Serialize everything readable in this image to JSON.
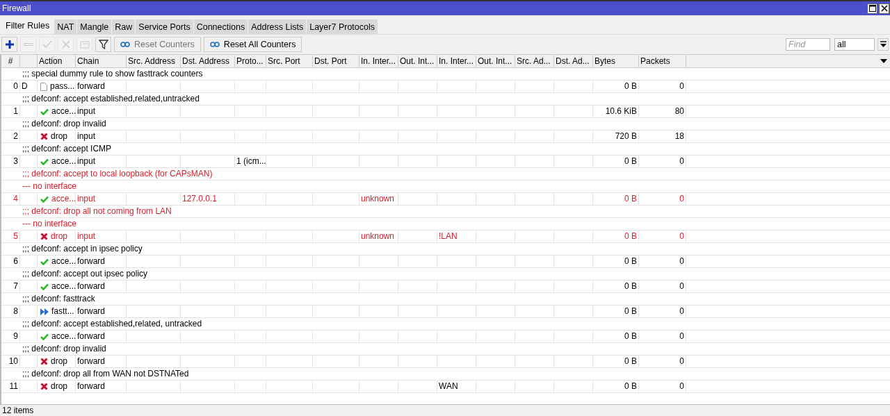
{
  "window": {
    "title": "Firewall"
  },
  "tabs": [
    {
      "label": "Filter Rules",
      "selected": true
    },
    {
      "label": "NAT",
      "selected": false
    },
    {
      "label": "Mangle",
      "selected": false
    },
    {
      "label": "Raw",
      "selected": false
    },
    {
      "label": "Service Ports",
      "selected": false
    },
    {
      "label": "Connections",
      "selected": false
    },
    {
      "label": "Address Lists",
      "selected": false
    },
    {
      "label": "Layer7 Protocols",
      "selected": false
    }
  ],
  "toolbar": {
    "icon_buttons": [
      {
        "kind": "add",
        "disabled": false
      },
      {
        "kind": "remove",
        "disabled": true
      },
      {
        "kind": "enable",
        "disabled": true
      },
      {
        "kind": "disable",
        "disabled": true
      },
      {
        "kind": "comment",
        "disabled": true
      },
      {
        "kind": "filter",
        "disabled": false
      }
    ],
    "text_buttons": [
      {
        "label": "Reset Counters",
        "disabled": true
      },
      {
        "label": "Reset All Counters",
        "disabled": false
      }
    ],
    "find": {
      "placeholder": "Find"
    },
    "scope": {
      "value": "all"
    }
  },
  "table": {
    "columns": [
      "#",
      "Action",
      "Chain",
      "Src. Address",
      "Dst. Address",
      "Proto...",
      "Src. Port",
      "Dst. Port",
      "In. Inter...",
      "Out. Int...",
      "In. Inter...",
      "Out. Int...",
      "Src. Ad...",
      "Dst. Ad...",
      "Bytes",
      "Packets"
    ],
    "rows": [
      {
        "kind": "comment",
        "invalid": false,
        "text": ";;; special dummy rule to show fasttrack counters"
      },
      {
        "kind": "rule",
        "invalid": false,
        "flag": "D",
        "cells": [
          "0",
          {
            "kind": "passthrough",
            "text": "pass..."
          },
          "forward",
          null,
          null,
          null,
          null,
          null,
          null,
          null,
          null,
          null,
          null,
          null,
          "0 B",
          "0"
        ]
      },
      {
        "kind": "comment",
        "invalid": false,
        "text": ";;; defconf: accept established,related,untracked"
      },
      {
        "kind": "rule",
        "invalid": false,
        "cells": [
          "1",
          {
            "kind": "accept",
            "text": "acce..."
          },
          "input",
          null,
          null,
          null,
          null,
          null,
          null,
          null,
          null,
          null,
          null,
          null,
          "10.6 KiB",
          "80"
        ]
      },
      {
        "kind": "comment",
        "invalid": false,
        "text": ";;; defconf: drop invalid"
      },
      {
        "kind": "rule",
        "invalid": false,
        "cells": [
          "2",
          {
            "kind": "drop",
            "text": "drop"
          },
          "input",
          null,
          null,
          null,
          null,
          null,
          null,
          null,
          null,
          null,
          null,
          null,
          "720 B",
          "18"
        ]
      },
      {
        "kind": "comment",
        "invalid": false,
        "text": ";;; defconf: accept ICMP"
      },
      {
        "kind": "rule",
        "invalid": false,
        "cells": [
          "3",
          {
            "kind": "accept",
            "text": "acce..."
          },
          "input",
          null,
          null,
          "1 (icm...",
          null,
          null,
          null,
          null,
          null,
          null,
          null,
          null,
          "0 B",
          "0"
        ]
      },
      {
        "kind": "comment",
        "invalid": true,
        "text": ";;; defconf: accept to local loopback (for CAPsMAN)"
      },
      {
        "kind": "comment",
        "invalid": true,
        "text": "--- no interface"
      },
      {
        "kind": "rule",
        "invalid": true,
        "cells": [
          "4",
          {
            "kind": "accept",
            "text": "acce..."
          },
          "input",
          null,
          "127.0.0.1",
          null,
          null,
          null,
          "unknown",
          null,
          null,
          null,
          null,
          null,
          "0 B",
          "0"
        ]
      },
      {
        "kind": "comment",
        "invalid": true,
        "text": ";;; defconf: drop all not coming from LAN"
      },
      {
        "kind": "comment",
        "invalid": true,
        "text": "--- no interface"
      },
      {
        "kind": "rule",
        "invalid": true,
        "cells": [
          "5",
          {
            "kind": "drop",
            "text": "drop"
          },
          "input",
          null,
          null,
          null,
          null,
          null,
          "unknown",
          null,
          "!LAN",
          null,
          null,
          null,
          "0 B",
          "0"
        ]
      },
      {
        "kind": "comment",
        "invalid": false,
        "text": ";;; defconf: accept in ipsec policy"
      },
      {
        "kind": "rule",
        "invalid": false,
        "cells": [
          "6",
          {
            "kind": "accept",
            "text": "acce..."
          },
          "forward",
          null,
          null,
          null,
          null,
          null,
          null,
          null,
          null,
          null,
          null,
          null,
          "0 B",
          "0"
        ]
      },
      {
        "kind": "comment",
        "invalid": false,
        "text": ";;; defconf: accept out ipsec policy"
      },
      {
        "kind": "rule",
        "invalid": false,
        "cells": [
          "7",
          {
            "kind": "accept",
            "text": "acce..."
          },
          "forward",
          null,
          null,
          null,
          null,
          null,
          null,
          null,
          null,
          null,
          null,
          null,
          "0 B",
          "0"
        ]
      },
      {
        "kind": "comment",
        "invalid": false,
        "text": ";;; defconf: fasttrack"
      },
      {
        "kind": "rule",
        "invalid": false,
        "cells": [
          "8",
          {
            "kind": "fasttrack",
            "text": "fastt..."
          },
          "forward",
          null,
          null,
          null,
          null,
          null,
          null,
          null,
          null,
          null,
          null,
          null,
          "0 B",
          "0"
        ]
      },
      {
        "kind": "comment",
        "invalid": false,
        "text": ";;; defconf: accept established,related, untracked"
      },
      {
        "kind": "rule",
        "invalid": false,
        "cells": [
          "9",
          {
            "kind": "accept",
            "text": "acce..."
          },
          "forward",
          null,
          null,
          null,
          null,
          null,
          null,
          null,
          null,
          null,
          null,
          null,
          "0 B",
          "0"
        ]
      },
      {
        "kind": "comment",
        "invalid": false,
        "text": ";;; defconf: drop invalid"
      },
      {
        "kind": "rule",
        "invalid": false,
        "cells": [
          "10",
          {
            "kind": "drop",
            "text": "drop"
          },
          "forward",
          null,
          null,
          null,
          null,
          null,
          null,
          null,
          null,
          null,
          null,
          null,
          "0 B",
          "0"
        ]
      },
      {
        "kind": "comment",
        "invalid": false,
        "text": ";;; defconf: drop all from WAN not DSTNATed"
      },
      {
        "kind": "rule",
        "invalid": false,
        "cells": [
          "11",
          {
            "kind": "drop",
            "text": "drop"
          },
          "forward",
          null,
          null,
          null,
          null,
          null,
          null,
          null,
          "WAN",
          null,
          null,
          null,
          "0 B",
          "0"
        ]
      }
    ]
  },
  "status_bar": {
    "text": "12 items"
  }
}
